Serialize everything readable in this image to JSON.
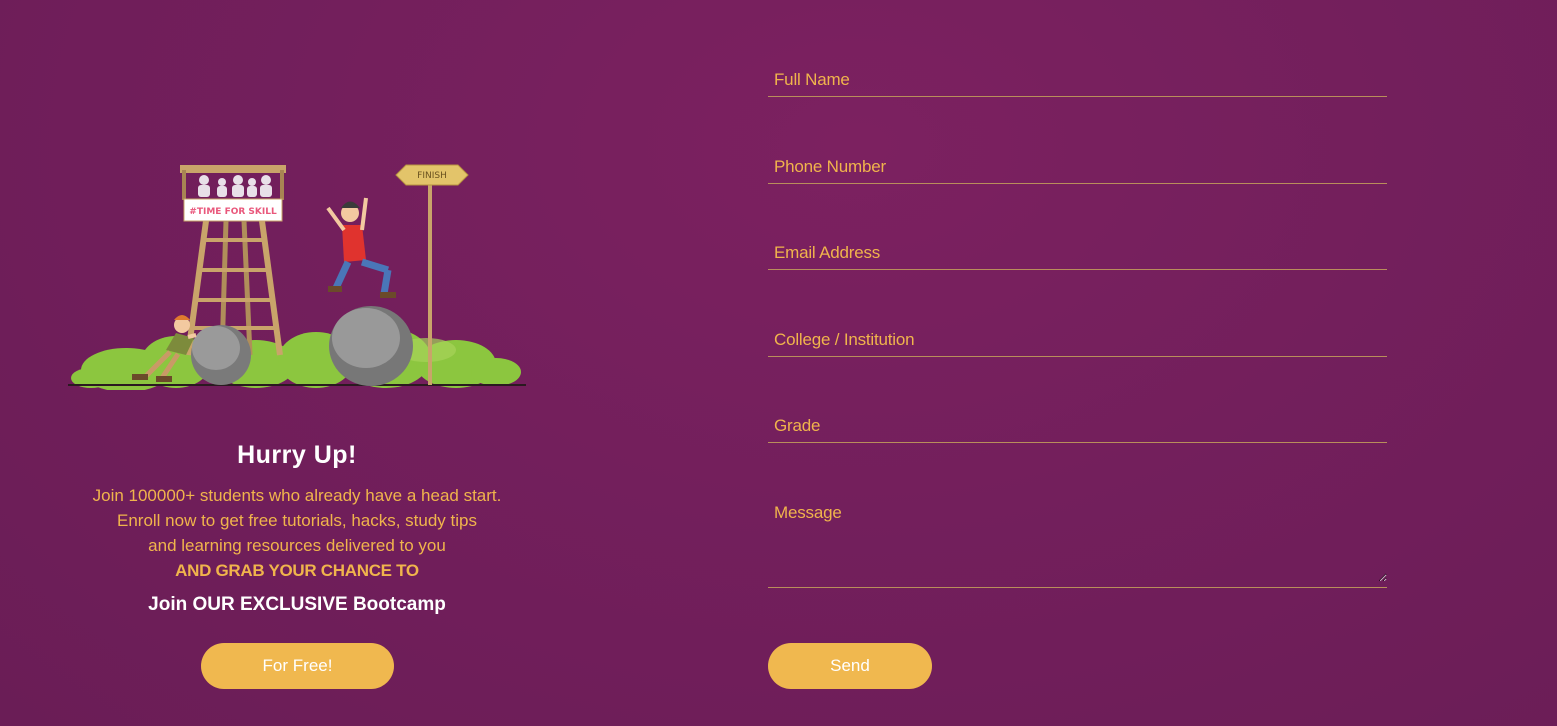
{
  "illustration": {
    "tower_banner": "#TIME FOR SKILL",
    "sign_label": "FINISH"
  },
  "hero": {
    "title": "Hurry Up!",
    "line1": "Join 100000+ students who already have a head start.",
    "line2": "Enroll now to get free tutorials, hacks, study tips",
    "line3": "and learning resources delivered to you",
    "line4": "AND GRAB YOUR CHANCE TO",
    "bootcamp": "Join OUR EXCLUSIVE Bootcamp",
    "cta_label": "For Free!"
  },
  "form": {
    "full_name_placeholder": "Full Name",
    "phone_placeholder": "Phone Number",
    "email_placeholder": "Email Address",
    "college_placeholder": "College / Institution",
    "grade_placeholder": "Grade",
    "message_placeholder": "Message",
    "send_label": "Send"
  },
  "colors": {
    "background": "#731f5c",
    "accent": "#f0b84f",
    "text_accent": "#f0b44c",
    "underline": "#b98e5b"
  }
}
